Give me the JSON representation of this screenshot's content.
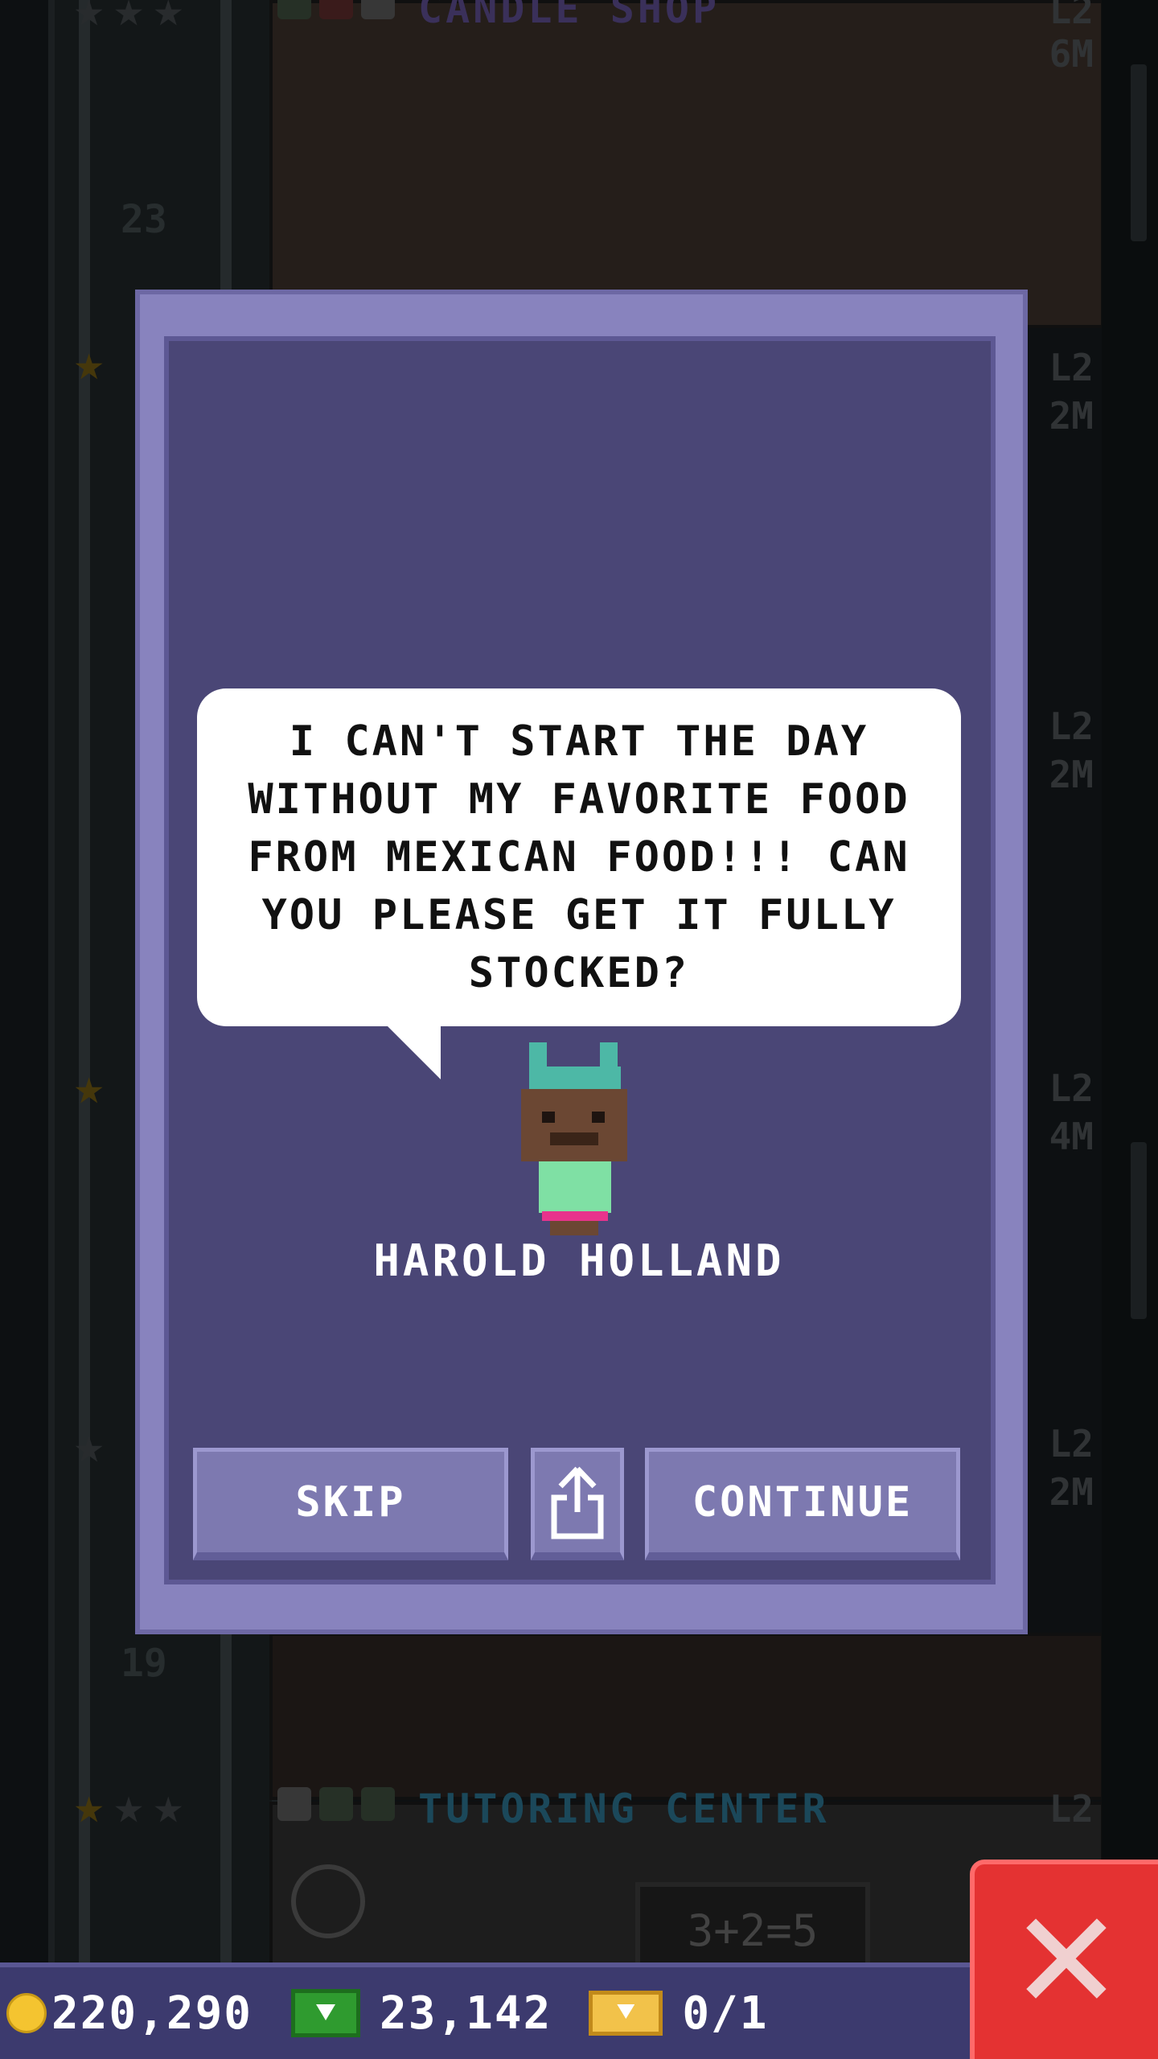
{
  "background": {
    "floors": [
      {
        "number": "23"
      },
      {
        "number": "19"
      }
    ],
    "rooms": [
      {
        "name": "CANDLE SHOP",
        "level": "L2",
        "price": "6M",
        "name_color": "#5a4a8a"
      },
      {
        "name": "TUTORING CENTER",
        "level": "L2",
        "price": "",
        "name_color": "#2a6f8a"
      }
    ],
    "side_levels": [
      "L2",
      "2M",
      "L2",
      "2M",
      "L2",
      "4M",
      "L2",
      "2M"
    ],
    "chalkboard_text": "3+2=5"
  },
  "dialog": {
    "message": "I CAN'T START THE DAY WITHOUT MY FAVORITE FOOD FROM MEXICAN FOOD!!! CAN YOU PLEASE GET IT FULLY STOCKED?",
    "character_name": "HAROLD HOLLAND",
    "buttons": {
      "skip": "SKIP",
      "continue": "CONTINUE"
    }
  },
  "currency": {
    "coins": "220,290",
    "bux": "23,142",
    "tickets": "0/1"
  },
  "colors": {
    "dialog_frame": "#8883be",
    "dialog_panel": "#4a4676",
    "button": "#7d79b0",
    "close_button": "#e43232",
    "bottom_bar": "#3c3a6e"
  },
  "icons": {
    "coin": "coin-icon",
    "bux": "bux-icon",
    "ticket": "ticket-icon",
    "share": "share-icon",
    "close": "close-icon"
  }
}
